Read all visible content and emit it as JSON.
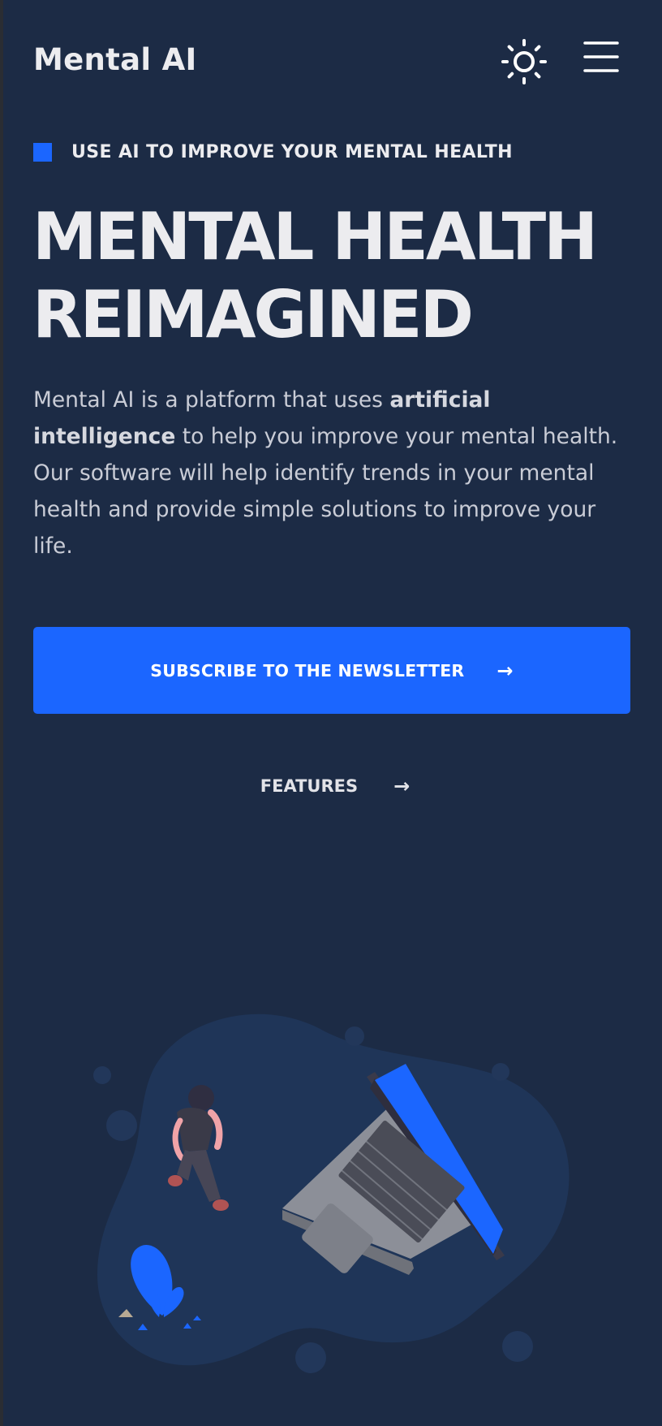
{
  "app": {
    "logo": "Mental AI"
  },
  "header": {
    "theme_icon": "sun-icon",
    "menu_icon": "hamburger-menu-icon"
  },
  "hero": {
    "eyebrow": "USE AI TO IMPROVE YOUR MENTAL HEALTH",
    "title_line1": "MENTAL HEALTH",
    "title_line2": "REIMAGINED",
    "desc_part1": "Mental AI is a platform that uses ",
    "desc_bold1": "artificial",
    "desc_bold2": "intelligence",
    "desc_part2": " to help you improve your mental health. Our software will help identify trends in your mental health and provide simple solutions to improve your life.",
    "cta_label": "SUBSCRIBE TO THE NEWSLETTER",
    "cta_arrow": "→",
    "features_label": "FEATURES",
    "features_arrow": "→"
  },
  "colors": {
    "background": "#1c2b45",
    "accent": "#1b66ff",
    "text": "#ececef",
    "illustration_blob": "#1f3558"
  }
}
